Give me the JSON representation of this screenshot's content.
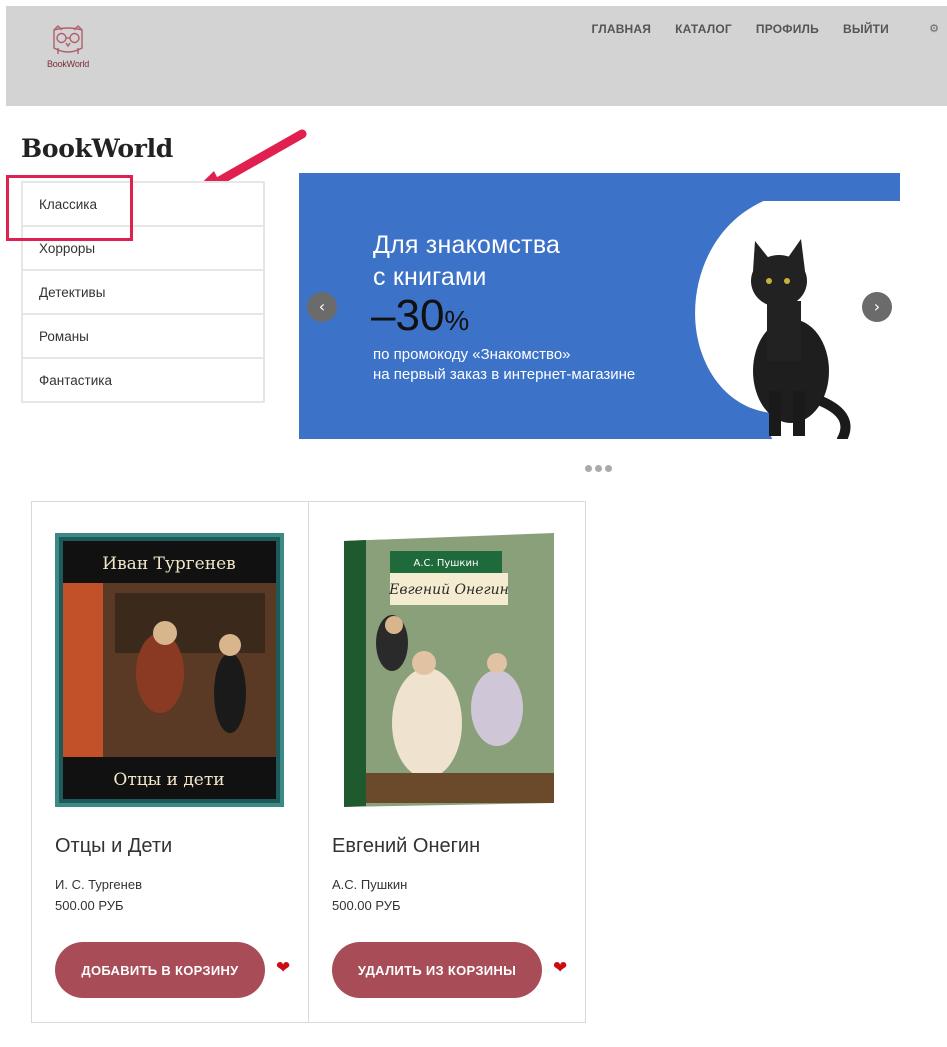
{
  "header": {
    "logo_text": "BookWorld",
    "nav": [
      "ГЛАВНАЯ",
      "КАТАЛОГ",
      "ПРОФИЛЬ",
      "ВЫЙТИ"
    ],
    "settings_icon": "⚙"
  },
  "site_title": "BookWorld",
  "categories": [
    "Классика",
    "Хорроры",
    "Детективы",
    "Романы",
    "Фантастика"
  ],
  "banner": {
    "line1": "Для знакомства",
    "line2": "с книгами",
    "discount": "–30",
    "percent": "%",
    "promo1": "по промокоду «Знакомство»",
    "promo2": "на первый заказ в интернет-магазине",
    "prev": "‹",
    "next": "›"
  },
  "products": [
    {
      "cover_author": "Иван Тургенев",
      "cover_title": "Отцы и дети",
      "title": "Отцы и Дети",
      "author": "И. С. Тургенев",
      "price": "500.00 РУБ",
      "button": "ДОБАВИТЬ В КОРЗИНУ"
    },
    {
      "cover_author": "А.С. Пушкин",
      "cover_title": "Евгений Онегин",
      "title": "Евгений Онегин",
      "author": "А.С. Пушкин",
      "price": "500.00 РУБ",
      "button": "УДАЛИТЬ ИЗ КОРЗИНЫ"
    }
  ],
  "colors": {
    "header_bg": "#d3d3d3",
    "banner_bg": "#3c72c7",
    "button_bg": "#a84d57",
    "highlight": "#e0204f",
    "heart": "#cc0c15"
  }
}
